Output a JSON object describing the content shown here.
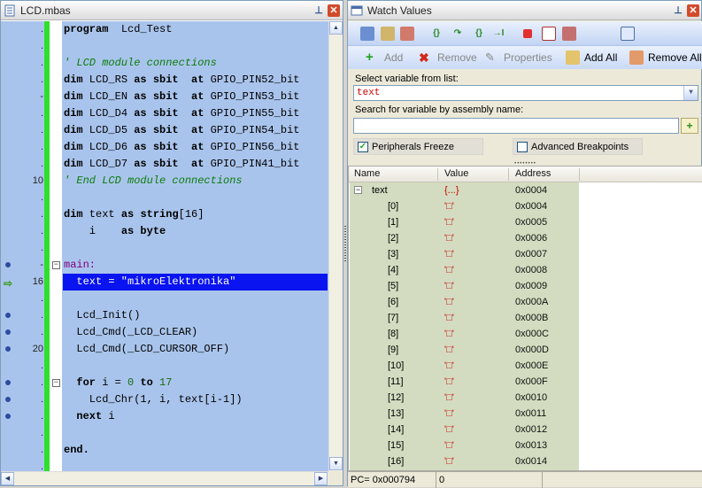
{
  "editor": {
    "title": "LCD.mbas",
    "lines": [
      {
        "num": ".",
        "html": "<span class='kw'>program</span>  Lcd_Test"
      },
      {
        "num": ".",
        "html": ""
      },
      {
        "num": ".",
        "html": "<span class='cm'>' LCD module connections</span>"
      },
      {
        "num": ".",
        "html": "<span class='kw'>dim</span> LCD_RS <span class='kw'>as</span> <span class='kw'>sbit</span>  <span class='kw'>at</span> GPIO_PIN52_bit"
      },
      {
        "num": "-",
        "html": "<span class='kw'>dim</span> LCD_EN <span class='kw'>as</span> <span class='kw'>sbit</span>  <span class='kw'>at</span> GPIO_PIN53_bit"
      },
      {
        "num": ".",
        "html": "<span class='kw'>dim</span> LCD_D4 <span class='kw'>as</span> <span class='kw'>sbit</span>  <span class='kw'>at</span> GPIO_PIN55_bit"
      },
      {
        "num": ".",
        "html": "<span class='kw'>dim</span> LCD_D5 <span class='kw'>as</span> <span class='kw'>sbit</span>  <span class='kw'>at</span> GPIO_PIN54_bit"
      },
      {
        "num": ".",
        "html": "<span class='kw'>dim</span> LCD_D6 <span class='kw'>as</span> <span class='kw'>sbit</span>  <span class='kw'>at</span> GPIO_PIN56_bit"
      },
      {
        "num": ".",
        "html": "<span class='kw'>dim</span> LCD_D7 <span class='kw'>as</span> <span class='kw'>sbit</span>  <span class='kw'>at</span> GPIO_PIN41_bit"
      },
      {
        "num": "10",
        "html": "<span class='cm'>' End LCD module connections</span>"
      },
      {
        "num": ".",
        "html": ""
      },
      {
        "num": ".",
        "html": "<span class='kw'>dim</span> text <span class='kw'>as</span> <span class='kw'>string</span>[16]"
      },
      {
        "num": ".",
        "html": "    i    <span class='kw'>as</span> <span class='kw'>byte</span>"
      },
      {
        "num": ".",
        "html": ""
      },
      {
        "num": "-",
        "html": "<span class='mn'>main:</span>",
        "bullet": true,
        "fold": "−"
      },
      {
        "num": "16",
        "html": "  text = \"mikroElektronika\"",
        "arrow": true,
        "highlight": true
      },
      {
        "num": ".",
        "html": ""
      },
      {
        "num": ".",
        "html": "  Lcd_Init()",
        "bullet": true
      },
      {
        "num": ".",
        "html": "  Lcd_Cmd(_LCD_CLEAR)",
        "bullet": true
      },
      {
        "num": "20",
        "html": "  Lcd_Cmd(_LCD_CURSOR_OFF)",
        "bullet": true
      },
      {
        "num": ".",
        "html": ""
      },
      {
        "num": ".",
        "html": "  <span class='kw'>for</span> i = <span class='nm'>0</span> <span class='kw'>to</span> <span class='nm'>17</span>",
        "bullet": true,
        "fold": "−"
      },
      {
        "num": ".",
        "html": "    Lcd_Chr(1, i, text[i-1])",
        "bullet": true
      },
      {
        "num": ".",
        "html": "  <span class='kw'>next</span> i",
        "bullet": true
      },
      {
        "num": ".",
        "html": ""
      },
      {
        "num": ".",
        "html": "<span class='kw'>end.</span>"
      },
      {
        "num": ".",
        "html": ""
      }
    ]
  },
  "watch": {
    "title": "Watch Values",
    "toolbar2": {
      "add": "Add",
      "remove": "Remove",
      "properties": "Properties",
      "add_all": "Add All",
      "remove_all": "Remove All"
    },
    "select_label": "Select variable from list:",
    "select_value": "text",
    "search_label": "Search for variable by assembly name:",
    "search_value": "",
    "peripherals_freeze": "Peripherals Freeze",
    "advanced_breakpoints": "Advanced Breakpoints",
    "columns": {
      "name": "Name",
      "value": "Value",
      "address": "Address"
    },
    "rows": [
      {
        "name": "text",
        "value": "{...}",
        "address": "0x0004",
        "indent": 0,
        "expander": true
      },
      {
        "name": "[0]",
        "value": "'□'",
        "address": "0x0004",
        "indent": 1
      },
      {
        "name": "[1]",
        "value": "'□'",
        "address": "0x0005",
        "indent": 1
      },
      {
        "name": "[2]",
        "value": "'□'",
        "address": "0x0006",
        "indent": 1
      },
      {
        "name": "[3]",
        "value": "'□'",
        "address": "0x0007",
        "indent": 1
      },
      {
        "name": "[4]",
        "value": "'□'",
        "address": "0x0008",
        "indent": 1
      },
      {
        "name": "[5]",
        "value": "'□'",
        "address": "0x0009",
        "indent": 1
      },
      {
        "name": "[6]",
        "value": "'□'",
        "address": "0x000A",
        "indent": 1
      },
      {
        "name": "[7]",
        "value": "'□'",
        "address": "0x000B",
        "indent": 1
      },
      {
        "name": "[8]",
        "value": "'□'",
        "address": "0x000C",
        "indent": 1
      },
      {
        "name": "[9]",
        "value": "'□'",
        "address": "0x000D",
        "indent": 1
      },
      {
        "name": "[10]",
        "value": "'□'",
        "address": "0x000E",
        "indent": 1
      },
      {
        "name": "[11]",
        "value": "'□'",
        "address": "0x000F",
        "indent": 1
      },
      {
        "name": "[12]",
        "value": "'□'",
        "address": "0x0010",
        "indent": 1
      },
      {
        "name": "[13]",
        "value": "'□'",
        "address": "0x0011",
        "indent": 1
      },
      {
        "name": "[14]",
        "value": "'□'",
        "address": "0x0012",
        "indent": 1
      },
      {
        "name": "[15]",
        "value": "'□'",
        "address": "0x0013",
        "indent": 1
      },
      {
        "name": "[16]",
        "value": "'□'",
        "address": "0x0014",
        "indent": 1
      }
    ],
    "status": {
      "pc": "PC= 0x000794",
      "value": "0"
    }
  }
}
